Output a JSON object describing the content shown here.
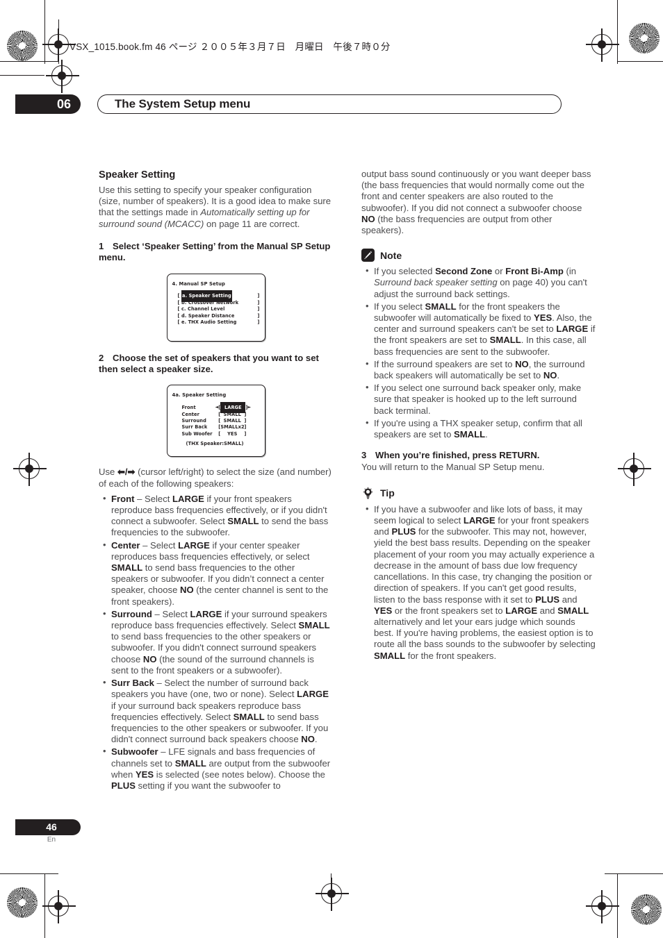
{
  "print_header": "VSX_1015.book.fm 46 ページ ２００５年３月７日　月曜日　午後７時０分",
  "chapter": {
    "number": "06",
    "title": "The System Setup menu"
  },
  "footer": {
    "page_number": "46",
    "language": "En"
  },
  "left_column": {
    "section_title": "Speaker Setting",
    "intro_1": "Use this setting to specify your speaker configuration (size, number of speakers). It is a good idea to make sure that the settings made in ",
    "intro_italic": "Automatically setting up for surround sound (MCACC)",
    "intro_2": " on page 11 are correct.",
    "step1_num": "1",
    "step1_text": "Select ‘Speaker Setting’ from the Manual SP Setup menu.",
    "step2_num": "2",
    "step2_text": "Choose the set of speakers that you want to set then select a speaker size.",
    "cursor_text_1": "Use ",
    "cursor_text_2": " (cursor left/right) to select the size (and number) of each of the following speakers:",
    "bullets": [
      {
        "term": "Front",
        "text": " – Select LARGE if your front speakers reproduce bass frequencies effectively, or if you didn't connect a subwoofer. Select SMALL to send the bass frequencies to the subwoofer."
      },
      {
        "term": "Center",
        "text": " – Select LARGE if your center speaker reproduces bass frequencies effectively, or select SMALL to send bass frequencies to the other speakers or subwoofer. If you didn’t connect a center speaker, choose NO (the center channel is sent to the front speakers)."
      },
      {
        "term": "Surround",
        "text": " – Select LARGE if your surround speakers reproduce bass frequencies effectively. Select SMALL to send bass frequencies to the other speakers or subwoofer. If you didn't connect surround speakers choose NO (the sound of the surround channels is sent to the front speakers or a subwoofer)."
      },
      {
        "term": "Surr Back",
        "text": " – Select the number of surround back speakers you have (one, two or none). Select LARGE if your surround back speakers reproduce bass frequencies effectively. Select SMALL to send bass frequencies to the other speakers or subwoofer. If you didn't connect surround back speakers choose NO."
      },
      {
        "term": "Subwoofer",
        "text": " – LFE signals and bass frequencies of channels set to SMALL are output from the subwoofer when YES is selected (see notes below). Choose the PLUS setting if you want the subwoofer to"
      }
    ]
  },
  "osd_menu_1": {
    "title": "4. Manual SP Setup",
    "items": [
      {
        "label": "a. Speaker Setting",
        "highlighted": true
      },
      {
        "label": "b. Crossover Network",
        "highlighted": false
      },
      {
        "label": "c. Channel Level",
        "highlighted": false
      },
      {
        "label": "d. Speaker Distance",
        "highlighted": false
      },
      {
        "label": "e. THX Audio Setting",
        "highlighted": false
      }
    ]
  },
  "osd_menu_2": {
    "title": "4a. Speaker Setting",
    "rows": [
      {
        "label": "Front",
        "value": "LARGE",
        "highlighted": true,
        "arrows": true
      },
      {
        "label": "Center",
        "value": "SMALL",
        "highlighted": false,
        "arrows": false
      },
      {
        "label": "Surround",
        "value": "SMALL",
        "highlighted": false,
        "arrows": false
      },
      {
        "label": "Surr Back",
        "value": "SMALLx2",
        "highlighted": false,
        "arrows": false
      },
      {
        "label": "Sub Woofer",
        "value": "YES",
        "highlighted": false,
        "arrows": false
      }
    ],
    "footnote": "(THX Speaker:SMALL)"
  },
  "right_column": {
    "continued_paragraph": "output bass sound continuously or you want deeper bass (the bass frequencies that would normally come out the front and center speakers are also routed to the subwoofer). If you did not connect a subwoofer choose NO (the bass frequencies are output from other speakers).",
    "note": {
      "icon": "pencil-icon",
      "label": "Note",
      "bullets": [
        "If you selected Second Zone or Front Bi-Amp (in Surround back speaker setting on page 40) you can't adjust the surround back settings.",
        "If you select SMALL for the front speakers the subwoofer will automatically be fixed to YES. Also, the center and surround speakers can't be set to LARGE if the front speakers are set to SMALL. In this case, all bass frequencies are sent to the subwoofer.",
        "If the surround speakers are set to NO, the surround back speakers will automatically be set to NO.",
        "If you select one surround back speaker only, make sure that speaker is hooked up to the left surround back terminal.",
        "If you're using a THX speaker setup, confirm that all speakers are set to SMALL."
      ]
    },
    "step3_num": "3",
    "step3_text": "When you’re finished, press RETURN.",
    "step3_body": "You will return to the Manual SP Setup menu.",
    "tip": {
      "icon": "lightbulb-icon",
      "label": "Tip",
      "bullets": [
        "If you have a subwoofer and like lots of bass, it may seem logical to select LARGE for your front speakers and PLUS for the subwoofer. This may not, however, yield the best bass results. Depending on the speaker placement of your room you may actually experience a decrease in the amount of bass due low frequency cancellations. In this case, try changing the position or direction of speakers. If you can't get good results, listen to the bass response with it set to PLUS and YES or the front speakers set to LARGE and SMALL alternatively and let your ears judge which sounds best. If you're having problems, the easiest option is to route all the bass sounds to the subwoofer by selecting SMALL for the front speakers."
      ]
    }
  },
  "colors": {
    "ink": "#231f20",
    "body_text": "#4c4c4e",
    "paper": "#ffffff"
  }
}
